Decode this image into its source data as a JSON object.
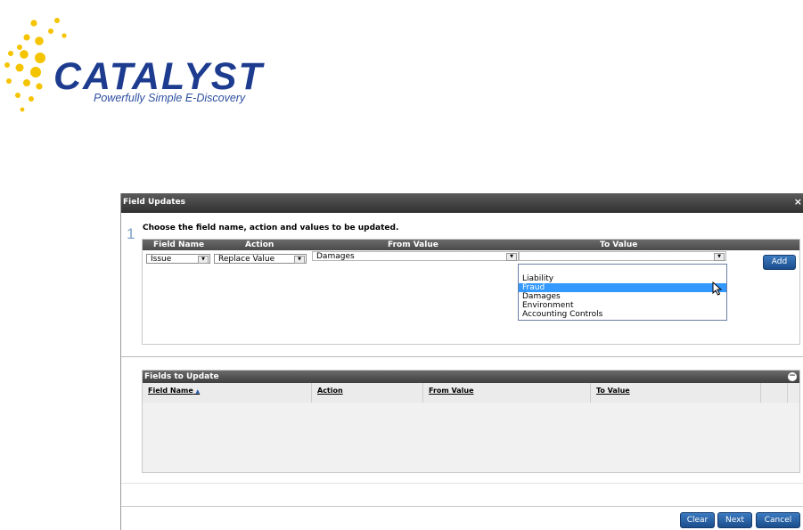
{
  "logo": {
    "wordmark": "CATALYST",
    "tagline": "Powerfully Simple E-Discovery",
    "colors": {
      "dots": "#f5c400",
      "text": "#1d3c8f"
    }
  },
  "dialog": {
    "title": "Field Updates",
    "close_glyph": "×",
    "step_number": "1",
    "instruction": "Choose the field name, action and values to be updated.",
    "form_headers": {
      "field_name": "Field Name",
      "action": "Action",
      "from_value": "From Value",
      "to_value": "To Value"
    },
    "field_name_select": {
      "value": "Issue"
    },
    "action_select": {
      "value": "Replace Value"
    },
    "from_value_select": {
      "value": "Damages"
    },
    "to_value_select": {
      "value": ""
    },
    "to_value_options": [
      "Liability",
      "Fraud",
      "Damages",
      "Environment",
      "Accounting Controls"
    ],
    "to_value_highlighted": "Fraud",
    "add_button": "Add",
    "fields_to_update": {
      "title": "Fields to Update",
      "collapse_glyph": "−",
      "columns": [
        "Field Name",
        "Action",
        "From Value",
        "To Value"
      ],
      "sort_indicator": "▲",
      "rows": []
    },
    "footer": {
      "clear": "Clear",
      "next": "Next",
      "cancel": "Cancel"
    }
  }
}
